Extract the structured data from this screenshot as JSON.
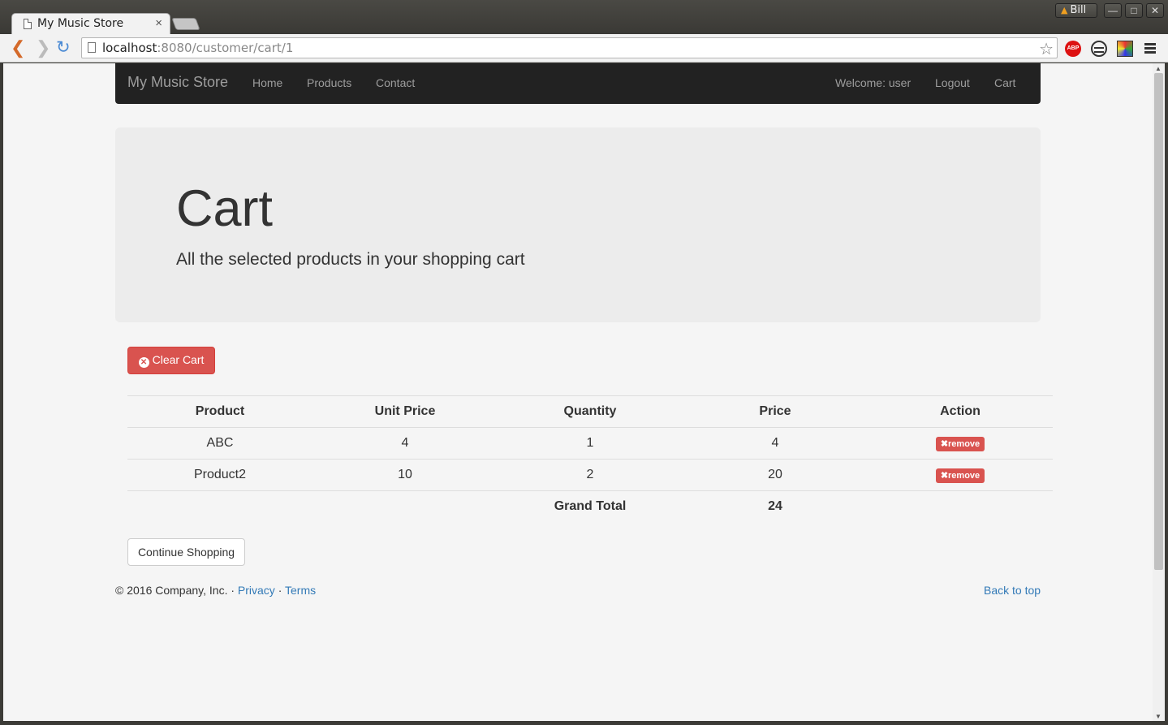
{
  "browser": {
    "tab_title": "My Music Store",
    "tab_close": "×",
    "user_name": "Bill",
    "url_host": "localhost",
    "url_rest": ":8080/customer/cart/1",
    "abp_label": "ABP",
    "window_buttons": [
      "—",
      "□",
      "✕"
    ]
  },
  "navbar": {
    "brand": "My Music Store",
    "links": [
      "Home",
      "Products",
      "Contact"
    ],
    "right_links": [
      "Welcome: user",
      "Logout",
      "Cart"
    ]
  },
  "jumbotron": {
    "title": "Cart",
    "subtitle": "All the selected products in your shopping cart"
  },
  "clear_cart_label": "Clear Cart",
  "table": {
    "headers": [
      "Product",
      "Unit Price",
      "Quantity",
      "Price",
      "Action"
    ],
    "rows": [
      {
        "product": "ABC",
        "unit_price": "4",
        "quantity": "1",
        "price": "4",
        "action": "remove"
      },
      {
        "product": "Product2",
        "unit_price": "10",
        "quantity": "2",
        "price": "20",
        "action": "remove"
      }
    ],
    "grand_total_label": "Grand Total",
    "grand_total": "24"
  },
  "continue_shopping_label": "Continue Shopping",
  "footer": {
    "copyright": "© 2016 Company, Inc. · ",
    "privacy": "Privacy",
    "separator": " · ",
    "terms": "Terms",
    "back_to_top": "Back to top"
  },
  "colors": {
    "danger": "#d9534f",
    "link": "#337ab7",
    "navbar_bg": "#222222"
  }
}
